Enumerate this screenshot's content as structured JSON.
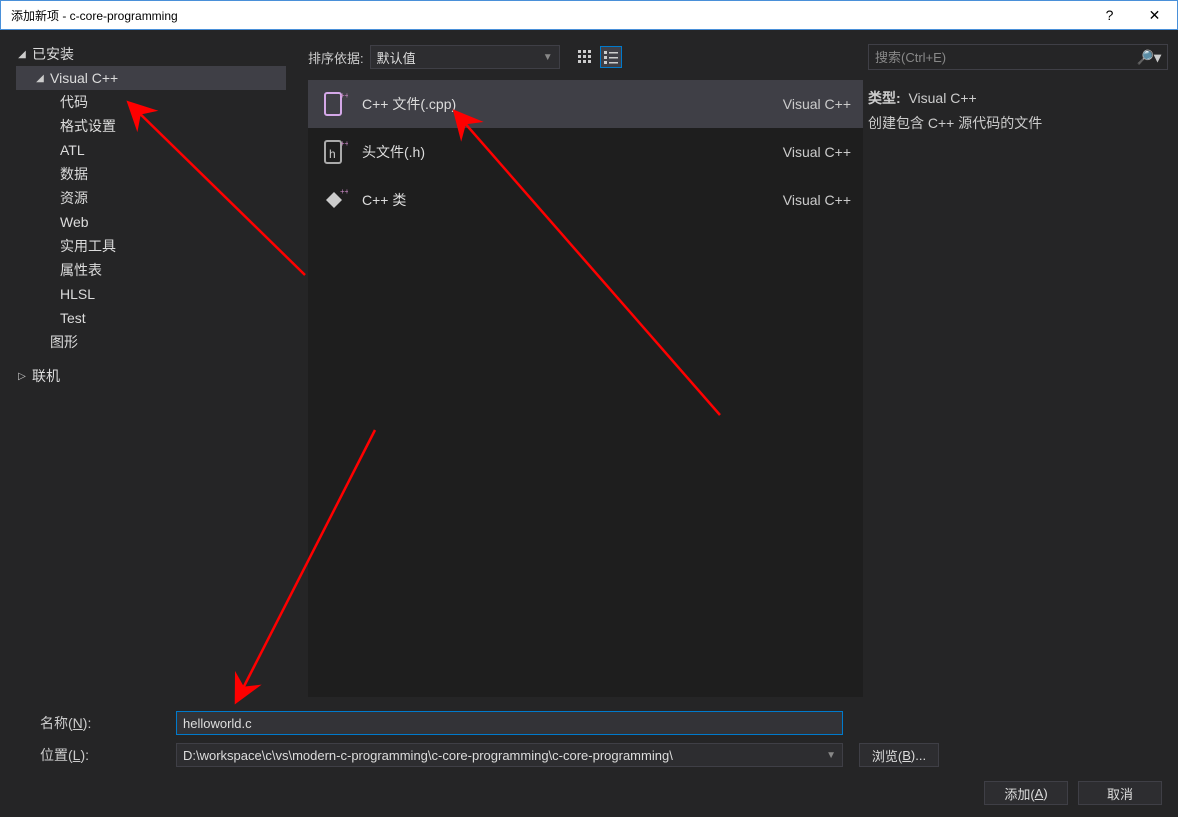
{
  "titlebar": {
    "title": "添加新项 - c-core-programming",
    "help": "?",
    "close": "✕"
  },
  "tree": {
    "installed": "已安装",
    "visualcpp": "Visual C++",
    "children": [
      "代码",
      "格式设置",
      "ATL",
      "数据",
      "资源",
      "Web",
      "实用工具",
      "属性表",
      "HLSL",
      "Test"
    ],
    "graphics": "图形",
    "online": "联机"
  },
  "topbar": {
    "sort_label": "排序依据:",
    "sort_value": "默认值",
    "search_placeholder": "搜索(Ctrl+E)"
  },
  "templates": [
    {
      "name": "C++ 文件(.cpp)",
      "lang": "Visual C++"
    },
    {
      "name": "头文件(.h)",
      "lang": "Visual C++"
    },
    {
      "name": "C++ 类",
      "lang": "Visual C++"
    }
  ],
  "info": {
    "type_label": "类型:",
    "type_value": "Visual C++",
    "desc": "创建包含 C++ 源代码的文件"
  },
  "form": {
    "name_label": "名称(N):",
    "name_value": "helloworld.c",
    "loc_label": "位置(L):",
    "loc_value": "D:\\workspace\\c\\vs\\modern-c-programming\\c-core-programming\\c-core-programming\\",
    "browse": "浏览(B)...",
    "add": "添加(A)",
    "cancel": "取消"
  }
}
